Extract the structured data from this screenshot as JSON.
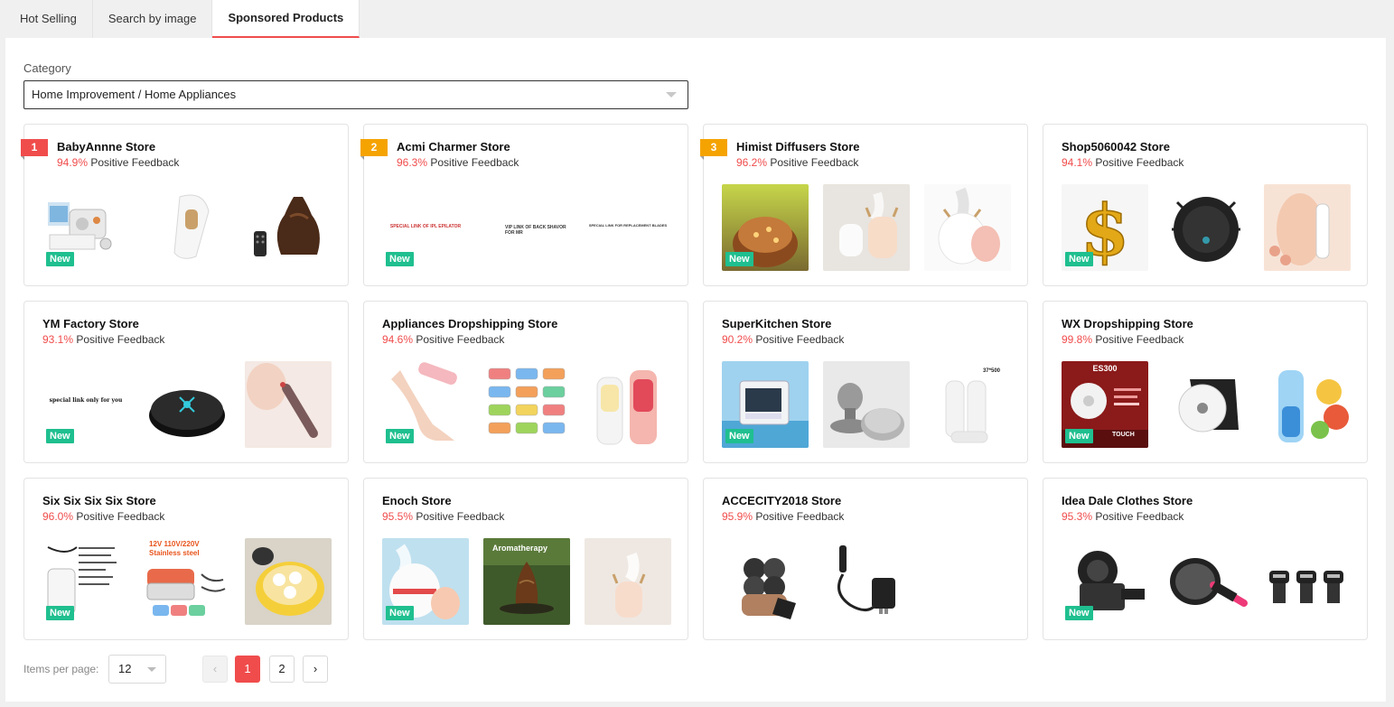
{
  "tabs": [
    {
      "label": "Hot Selling",
      "active": false
    },
    {
      "label": "Search by image",
      "active": false
    },
    {
      "label": "Sponsored Products",
      "active": true
    }
  ],
  "category": {
    "label": "Category",
    "value": "Home Improvement / Home Appliances"
  },
  "feedback_suffix": "Positive Feedback",
  "new_label": "New",
  "stores": [
    {
      "rank": "1",
      "rank_color": "#f04c4c",
      "name": "BabyAnnne Store",
      "pct": "94.9%",
      "new": true,
      "thumbs": [
        "beauty-device-kit",
        "ipl-epilator",
        "aroma-diffuser-dark"
      ]
    },
    {
      "rank": "2",
      "rank_color": "#f5a300",
      "name": "Acmi Charmer Store",
      "pct": "96.3%",
      "new": true,
      "thumbs": [
        "text-SPECIAL LINK OF IPL EPILATOR",
        "text-VIP LINK OF BACK SHAVOR FOR MR",
        "text-SPECIAL LINK FOR REPLACEMENT BLADES"
      ]
    },
    {
      "rank": "3",
      "rank_color": "#f5a300",
      "name": "Himist Diffusers Store",
      "pct": "96.2%",
      "new": true,
      "thumbs": [
        "wood-diffuser",
        "deer-humidifiers",
        "pink-humidifier"
      ]
    },
    {
      "rank": "",
      "rank_color": "",
      "name": "Shop5060042 Store",
      "pct": "94.1%",
      "new": true,
      "thumbs": [
        "dollar-sign",
        "robot-vacuum",
        "skin-scrubber"
      ]
    },
    {
      "rank": "",
      "rank_color": "",
      "name": "YM Factory Store",
      "pct": "93.1%",
      "new": true,
      "thumbs": [
        "text-special link only for you",
        "robot-vacuum-round",
        "nose-device"
      ]
    },
    {
      "rank": "",
      "rank_color": "",
      "name": "Appliances Dropshipping Store",
      "pct": "94.6%",
      "new": true,
      "thumbs": [
        "callus-remover",
        "lunch-box-grid",
        "portable-blenders"
      ]
    },
    {
      "rank": "",
      "rank_color": "",
      "name": "SuperKitchen Store",
      "pct": "90.2%",
      "new": true,
      "thumbs": [
        "air-cooler",
        "coffee-tamper",
        "vacuum-bag-rolls"
      ]
    },
    {
      "rank": "",
      "rank_color": "",
      "name": "WX Dropshipping Store",
      "pct": "99.8%",
      "new": true,
      "thumbs": [
        "es300-vacuum",
        "mini-vacuum-white",
        "blue-blender"
      ]
    },
    {
      "rank": "",
      "rank_color": "",
      "name": "Six Six Six Six Store",
      "pct": "96.0%",
      "new": true,
      "thumbs": [
        "lunch-box-spec",
        "stainless-lunch-box",
        "egg-cooker"
      ]
    },
    {
      "rank": "",
      "rank_color": "",
      "name": "Enoch Store",
      "pct": "95.5%",
      "new": true,
      "thumbs": [
        "bear-humidifier",
        "aromatherapy-diffuser",
        "deer-humidifier"
      ]
    },
    {
      "rank": "",
      "rank_color": "",
      "name": "ACCECITY2018 Store",
      "pct": "95.9%",
      "new": false,
      "thumbs": [
        "shaver-head",
        "charger-cable",
        "blank"
      ]
    },
    {
      "rank": "",
      "rank_color": "",
      "name": "Idea Dale Clothes Store",
      "pct": "95.3%",
      "new": true,
      "thumbs": [
        "bike-mount",
        "hair-dryer-brush",
        "shaver-heads-set"
      ]
    }
  ],
  "thumb_text": {
    "a1": "SPECIAL LINK OF IPL EPILATOR",
    "a2": "VIP LINK OF BACK SHAVOR FOR MR",
    "a3": "SPECIAL LINK FOR REPLACEMENT BLADES",
    "ym": "special link only for you",
    "es300": "ES300",
    "touch": "TOUCH",
    "steel_line1": "12V 110V/220V",
    "steel_line2": "Stainless steel",
    "aroma": "Aromatherapy",
    "roll": "37*500"
  },
  "pagination": {
    "label": "Items per page:",
    "per_page": "12",
    "prev": "‹",
    "next": "›",
    "pages": [
      "1",
      "2"
    ],
    "current": "1"
  }
}
